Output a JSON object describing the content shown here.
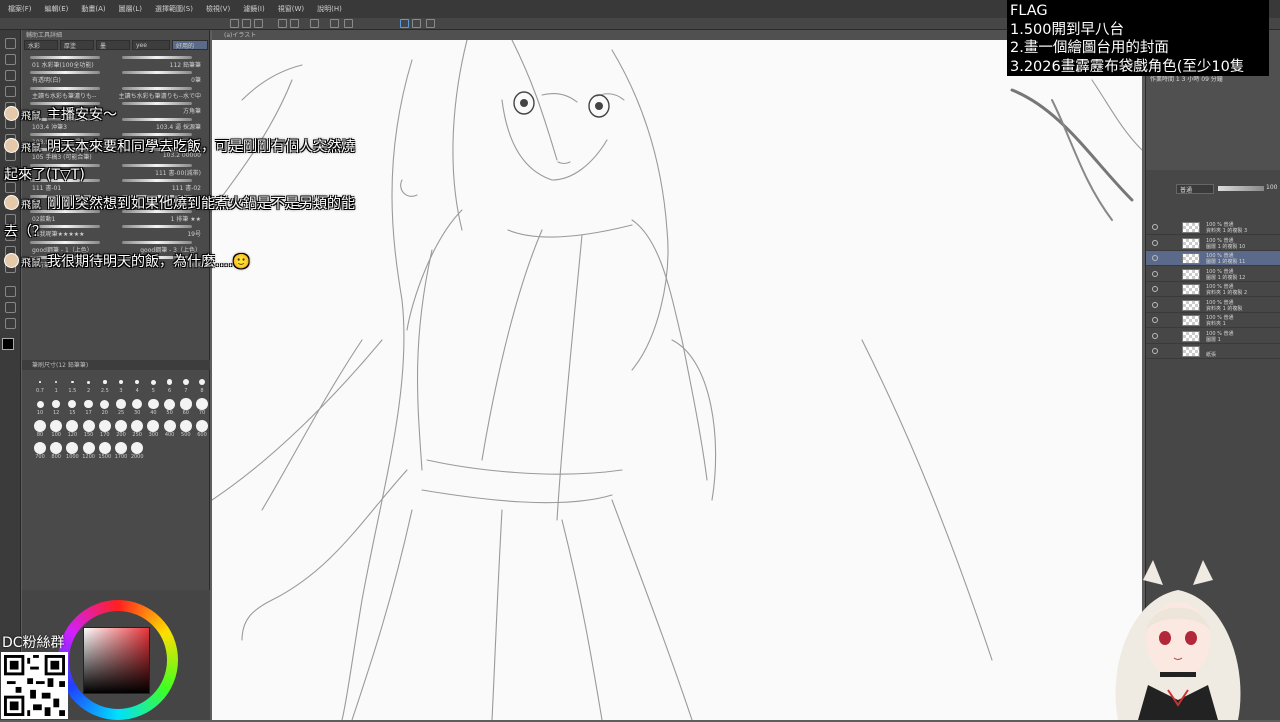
{
  "menu": [
    "檔案(F)",
    "編輯(E)",
    "動畫(A)",
    "圖層(L)",
    "選擇範圍(S)",
    "檢視(V)",
    "濾鏡(I)",
    "視窗(W)",
    "說明(H)"
  ],
  "doc_tab": "(a)イラスト",
  "left_panel": {
    "tabs": [
      "水彩",
      "厚塗",
      "墨",
      "yee",
      "好用的"
    ],
    "header": "輔助工具詳細",
    "brushes": [
      {
        "left": "01 水彩筆(100全功能)",
        "right": "112 鉛筆筆"
      },
      {
        "left": "有透明(白)",
        "right": "0筆"
      },
      {
        "left": "主讀ち水彩も筆濃りも--",
        "right": "主讀ち水彩も筆濃りも--水で中"
      },
      {
        "left": "",
        "right": "方角筆"
      },
      {
        "left": "103.4 沖筆3",
        "right": "103.4 逼 採源筆"
      },
      {
        "left": "103.9 淡薄汁淡漫",
        "right": "103.9 淡(白筆)(2全)"
      },
      {
        "left": "105 手稿3 (可能合筆)",
        "right": "103.2 00000"
      },
      {
        "left": "",
        "right": "111 書-00(減帯)"
      },
      {
        "left": "111 書-01",
        "right": "111 書-02"
      },
      {
        "left": "",
        "right": "1 掃筆 ★★"
      },
      {
        "left": "02款動1",
        "right": "1 排筆 ★★"
      },
      {
        "left": "11我呢筆★★★★★",
        "right": "19号"
      },
      {
        "left": "good鋼筆 - 1（上色）",
        "right": "good鋼筆 - 3（上色）"
      },
      {
        "left": "方方筆",
        "right": "細節DEX"
      }
    ],
    "size_header": "筆刷尺寸(12 鉛筆筆)",
    "sizes": [
      "0.7",
      "1",
      "1.5",
      "2",
      "2.5",
      "3",
      "4",
      "5",
      "6",
      "7",
      "8",
      "10",
      "12",
      "15",
      "17",
      "20",
      "25",
      "30",
      "40",
      "50",
      "60",
      "70",
      "80",
      "100",
      "120",
      "150",
      "170",
      "200",
      "250",
      "300",
      "400",
      "500",
      "600",
      "700",
      "800",
      "1000",
      "1200",
      "1500",
      "1700",
      "2000"
    ]
  },
  "flag": {
    "title": "FLAG",
    "items": [
      "1.500開到早八台",
      "2.畫一個繪圖台用的封面",
      "3.2026畫霹靂布袋戲角色(至少10隻"
    ]
  },
  "chat": [
    {
      "name": "飛鼠",
      "text": "主播安安～"
    },
    {
      "name": "飛鼠",
      "text": "明天本來要和同學去吃飯，可是剛剛有個人突然燒起來了(T▽T)"
    },
    {
      "name": "飛鼠",
      "text": "剛剛突然想到如果他燒到能煮火鍋是不是另類的能去（？"
    },
    {
      "name": "飛鼠",
      "text": "我很期待明天的飯，為什麼....🙂"
    }
  ],
  "right_panel": {
    "work_time": "作業時間 1   3 小時 09 分鐘",
    "blend": "普通",
    "opacity": "100",
    "layers": [
      {
        "line1": "100 % 普通",
        "line2": "資料夾 1 的複製 3"
      },
      {
        "line1": "100 % 普通",
        "line2": "圖層 1 的複製 10"
      },
      {
        "line1": "100 % 普通",
        "line2": "圖層 1 的複製 11"
      },
      {
        "line1": "100 % 普通",
        "line2": "圖層 1 的複製 12"
      },
      {
        "line1": "100 % 普通",
        "line2": "資料夾 1 的複製 2"
      },
      {
        "line1": "100 % 普通",
        "line2": "資料夾 1 的複製"
      },
      {
        "line1": "100 % 普通",
        "line2": "資料夾 1"
      },
      {
        "line1": "100 % 普通",
        "line2": "圖層 1"
      },
      {
        "line1": "",
        "line2": "紙張"
      }
    ]
  },
  "dc_label": "DC粉絲群"
}
